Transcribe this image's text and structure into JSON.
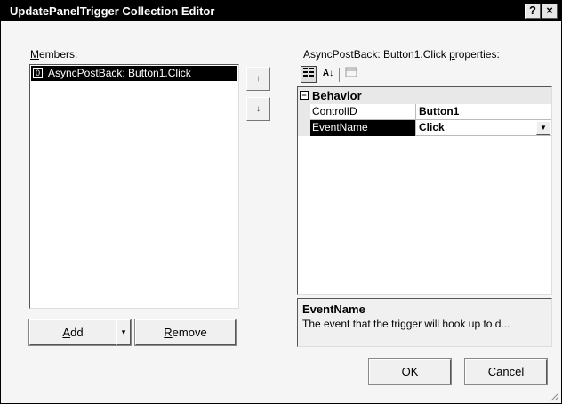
{
  "window": {
    "title": "UpdatePanelTrigger Collection Editor",
    "help_label": "?",
    "close_label": "×"
  },
  "members": {
    "label": "Members:",
    "items": [
      {
        "index": "0",
        "text": "AsyncPostBack: Button1.Click",
        "selected": true
      }
    ],
    "up_arrow": "↑",
    "down_arrow": "↓"
  },
  "buttons": {
    "add_prefix": "",
    "add_mnemonic": "A",
    "add_rest": "dd",
    "add_dropdown": "▾",
    "remove_prefix": "",
    "remove_mnemonic": "R",
    "remove_rest": "emove",
    "ok": "OK",
    "cancel": "Cancel"
  },
  "properties": {
    "label_prefix": "AsyncPostBack: Button1.Click ",
    "label_mnemonic": "p",
    "label_rest": "roperties:",
    "toolbar": {
      "categorized_icon": "categorized-icon",
      "alphabetical_icon": "alphabetical-icon",
      "property_pages_icon": "property-pages-icon",
      "alpha_glyph": "A↓"
    },
    "category": {
      "toggle": "−",
      "name": "Behavior"
    },
    "rows": [
      {
        "name": "ControlID",
        "value": "Button1"
      },
      {
        "name": "EventName",
        "value": "Click",
        "selected": true
      }
    ],
    "combo_arrow": "▼"
  },
  "description": {
    "title": "EventName",
    "text": "The event that the trigger will hook up to d..."
  },
  "colors": {
    "selection": "#000000",
    "dialog_bg": "#f5f5f5",
    "titlebar": "#000000"
  }
}
